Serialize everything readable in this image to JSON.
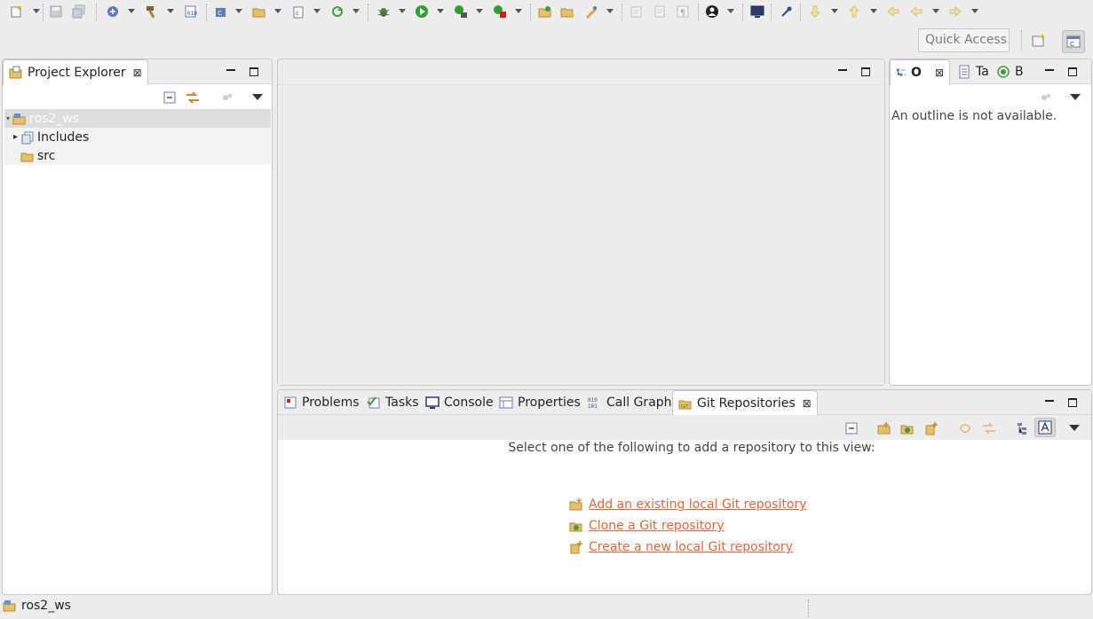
{
  "toolbar": {
    "icons": [
      "new-icon",
      "save-icon",
      "save-all-icon",
      "debug-config-icon",
      "build-hammer-icon",
      "binary-icon",
      "new-class-icon",
      "new-folder-icon",
      "new-source-icon",
      "refresh-icon",
      "bug-icon",
      "run-icon",
      "run-config-icon",
      "stop-icon",
      "open-type-icon",
      "open-folder-icon",
      "launch-icon",
      "mark-icon",
      "task-icon",
      "paragraph-icon",
      "account-icon",
      "terminal-icon",
      "pin-icon",
      "next-annotation-icon",
      "prev-annotation-icon",
      "last-edit-icon",
      "back-icon",
      "forward-icon"
    ]
  },
  "quick_access": {
    "placeholder": "Quick Access"
  },
  "project_explorer": {
    "title": "Project Explorer",
    "tree": [
      {
        "label": "ros2_ws",
        "selected": true
      },
      {
        "label": "Includes"
      },
      {
        "label": "src"
      }
    ]
  },
  "outline": {
    "tabs": [
      "O",
      "Ta",
      "B"
    ],
    "message": "An outline is not available."
  },
  "bottom": {
    "tabs": [
      "Problems",
      "Tasks",
      "Console",
      "Properties",
      "Call Graph",
      "Git Repositories"
    ],
    "active_tab": "Git Repositories",
    "intro": "Select one of the following to add a repository to this view:",
    "links": [
      "Add an existing local Git repository",
      "Clone a Git repository",
      "Create a new local Git repository"
    ]
  },
  "status": {
    "text": "ros2_ws"
  },
  "colors": {
    "link": "#e3643a",
    "accent": "#3b6fc7"
  }
}
